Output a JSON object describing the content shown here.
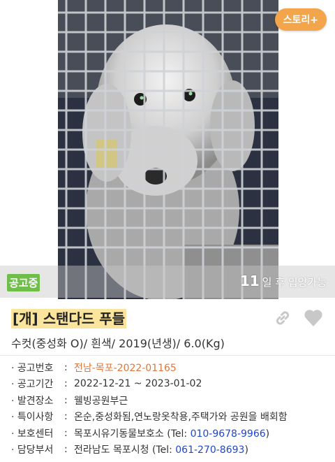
{
  "photo": {
    "story_button": "스토리+",
    "status": "공고중",
    "days_number": "11",
    "days_text": "일 후 입양가능"
  },
  "listing": {
    "title": "[개] 스탠다드 푸들",
    "summary": "수컷(중성화 O)/ 흰색/ 2019(년생)/ 6.0(Kg)"
  },
  "info": {
    "notice_no": {
      "label": "공고번호",
      "value": "전남-목포-2022-01165"
    },
    "notice_period": {
      "label": "공고기간",
      "value": "2022-12-21 ~ 2023-01-02"
    },
    "found_place": {
      "label": "발견장소",
      "value": "웰빙공원부근"
    },
    "notes": {
      "label": "특이사항",
      "value": "온순,중성화됨,연노랑옷착용,주택가와 공원을 배회함"
    },
    "shelter": {
      "label": "보호센터",
      "value": "목포시유기동물보호소 (Tel: ",
      "tel": "010-9678-9966",
      "suffix": ")"
    },
    "department": {
      "label": "담당부서",
      "value": "전라남도 목포시청 (Tel: ",
      "tel": "061-270-8693",
      "suffix": ")"
    }
  },
  "colors": {
    "accent": "#f2a54a",
    "status": "#6fbe4a",
    "highlight": "#fbe49b",
    "link": "#2147c9",
    "notice": "#e0773a"
  }
}
